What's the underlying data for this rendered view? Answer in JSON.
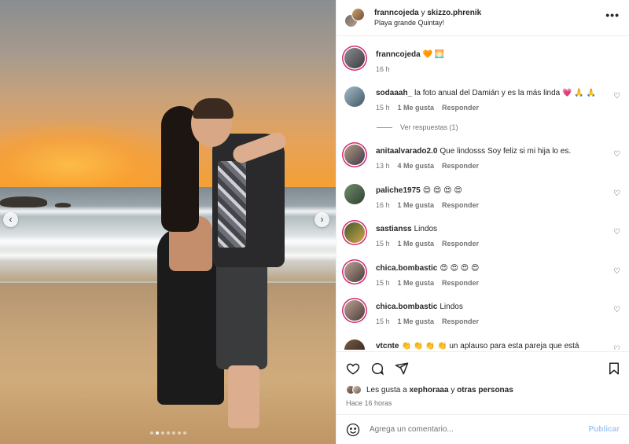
{
  "header": {
    "user1": "franncojeda",
    "joiner": "y",
    "user2": "skizzo.phrenik",
    "location": "Playa grande Quintay!",
    "menu": "•••"
  },
  "caption": {
    "user": "franncojeda",
    "text": "🧡 🌅",
    "time": "16 h"
  },
  "comments": [
    {
      "user": "sodaaah_",
      "text": "la foto anual del Damián y es la más linda 💗 🙏 🙏",
      "time": "15 h",
      "likes": "1 Me gusta",
      "reply": "Responder"
    },
    {
      "user": "anitaalvarado2.0",
      "text": "Que lindosss Soy feliz si mi hija lo es.",
      "time": "13 h",
      "likes": "4 Me gusta",
      "reply": "Responder"
    },
    {
      "user": "paliche1975",
      "text": "😍 😍 😍 😍",
      "time": "16 h",
      "likes": "1 Me gusta",
      "reply": "Responder"
    },
    {
      "user": "sastianss",
      "text": "Lindos",
      "time": "15 h",
      "likes": "1 Me gusta",
      "reply": "Responder"
    },
    {
      "user": "chica.bombastic",
      "text": "😍 😍 😍 😍",
      "time": "15 h",
      "likes": "1 Me gusta",
      "reply": "Responder"
    },
    {
      "user": "chica.bombastic",
      "text": "Lindos",
      "time": "15 h",
      "likes": "1 Me gusta",
      "reply": "Responder"
    },
    {
      "user": "vtcnte",
      "text": "👏 👏 👏 👏 un aplauso para esta pareja que está",
      "time": "",
      "likes": "",
      "reply": ""
    }
  ],
  "view_replies": "Ver respuestas (1)",
  "likes_line": {
    "prefix": "Les gusta a",
    "user": "xephoraaa",
    "joiner": "y",
    "others": "otras personas"
  },
  "time_ago": "Hace 16 horas",
  "comment_box": {
    "placeholder": "Agrega un comentario...",
    "publish": "Publicar"
  },
  "carousel": {
    "total": 7,
    "active": 1
  },
  "colors": {
    "accent_ring": "#d62976",
    "publish_disabled": "#a8c7fa",
    "muted": "#737373"
  }
}
